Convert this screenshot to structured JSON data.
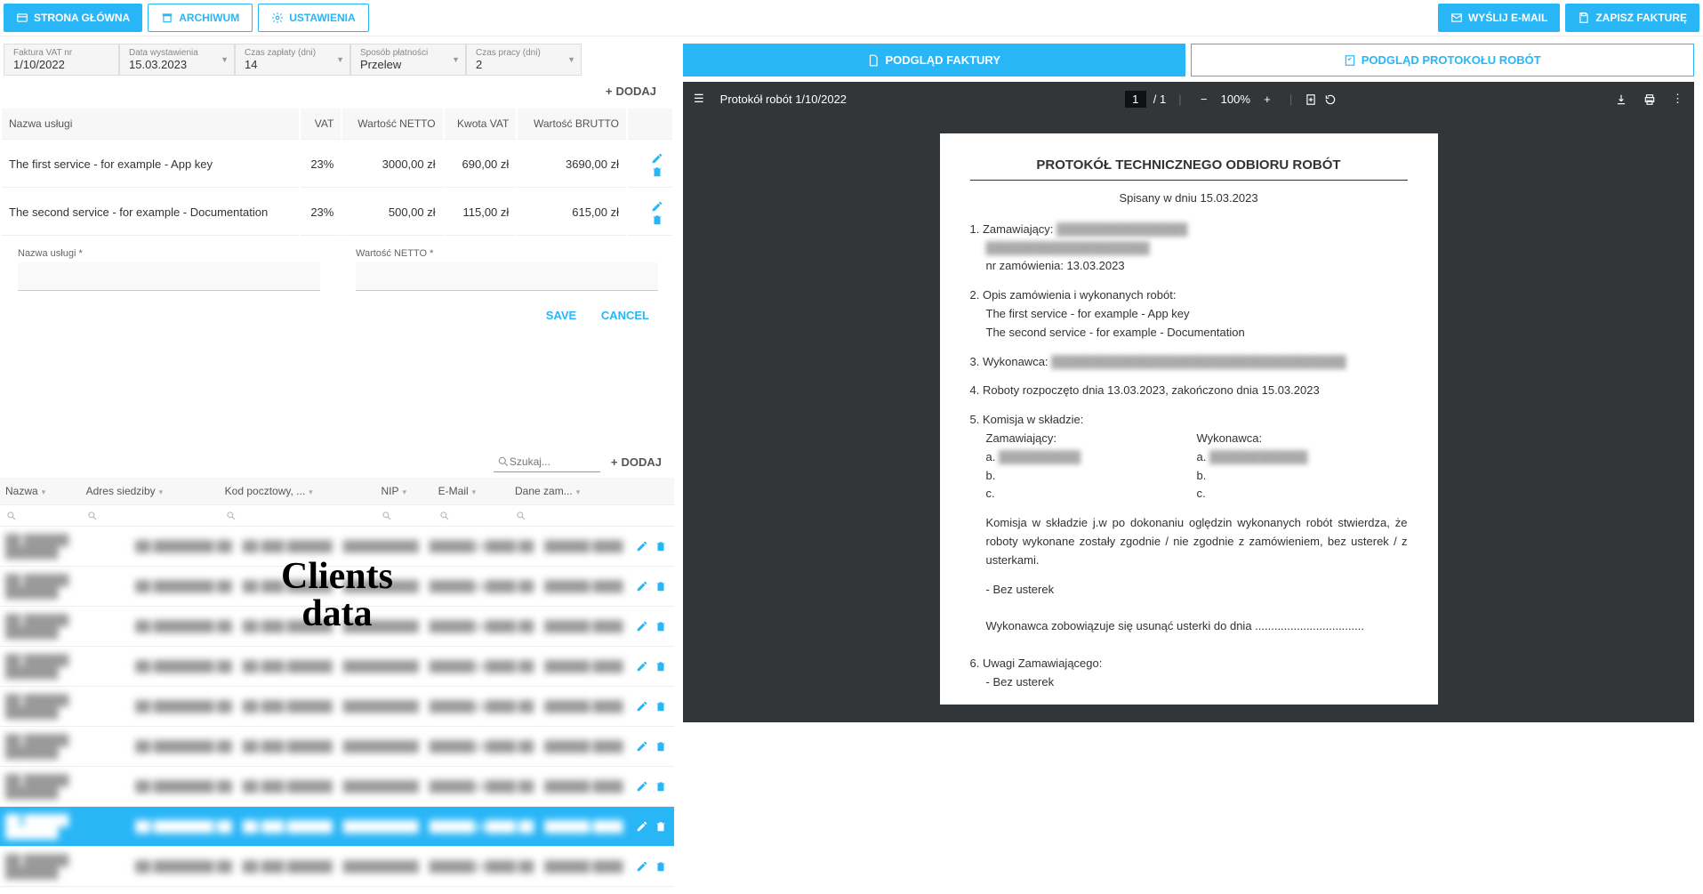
{
  "nav": {
    "home": "STRONA GŁÓWNA",
    "archive": "ARCHIWUM",
    "settings": "USTAWIENIA",
    "send_email": "WYŚLIJ E-MAIL",
    "save_invoice": "ZAPISZ FAKTURĘ"
  },
  "invoice_form": {
    "number_label": "Faktura VAT nr",
    "number_value": "1/10/2022",
    "date_label": "Data wystawienia",
    "date_value": "15.03.2023",
    "payment_time_label": "Czas zapłaty (dni)",
    "payment_time_value": "14",
    "payment_method_label": "Sposób płatności",
    "payment_method_value": "Przelew",
    "work_time_label": "Czas pracy (dni)",
    "work_time_value": "2"
  },
  "add_label": "DODAJ",
  "services": {
    "headers": {
      "name": "Nazwa usługi",
      "vat": "VAT",
      "netto": "Wartość NETTO",
      "vat_amount": "Kwota VAT",
      "brutto": "Wartość BRUTTO"
    },
    "rows": [
      {
        "name": "The first service - for example - App key",
        "vat": "23%",
        "netto": "3000,00 zł",
        "vat_amount": "690,00 zł",
        "brutto": "3690,00 zł"
      },
      {
        "name": "The second service - for example - Documentation",
        "vat": "23%",
        "netto": "500,00 zł",
        "vat_amount": "115,00 zł",
        "brutto": "615,00 zł"
      }
    ]
  },
  "edit": {
    "name_label": "Nazwa usługi *",
    "netto_label": "Wartość NETTO *",
    "save": "SAVE",
    "cancel": "CANCEL"
  },
  "clients": {
    "search_placeholder": "Szukaj...",
    "add": "DODAJ",
    "headers": {
      "name": "Nazwa",
      "address": "Adres siedziby",
      "postal": "Kod pocztowy, ...",
      "nip": "NIP",
      "email": "E-Mail",
      "order_data": "Dane zam..."
    },
    "overlay": "Clients\ndata"
  },
  "tabs": {
    "invoice_preview": "PODGLĄD FAKTURY",
    "protocol_preview": "PODGLĄD PROTOKOŁU ROBÓT"
  },
  "pdf": {
    "title": "Protokół robót 1/10/2022",
    "page": "1",
    "total": "/ 1",
    "zoom": "100%",
    "doc": {
      "heading": "PROTOKÓŁ TECHNICZNEGO ODBIORU ROBÓT",
      "written": "Spisany w dniu 15.03.2023",
      "p1_label": "1. Zamawiający:",
      "p1_order": "nr zamówienia: 13.03.2023",
      "p2_label": "2. Opis zamówienia i wykonanych robót:",
      "p2_line1": "The first service - for example - App key",
      "p2_line2": "The second service - for example - Documentation",
      "p3_label": "3. Wykonawca:",
      "p4": "4. Roboty rozpoczęto dnia 13.03.2023, zakończono dnia 15.03.2023",
      "p5_label": "5. Komisja w składzie:",
      "p5_left": "Zamawiający:",
      "p5_right": "Wykonawca:",
      "a": "a.",
      "b": "b.",
      "c": "c.",
      "findings": "Komisja w składzie j.w po dokonaniu oględzin wykonanych robót stwierdza, że roboty wykonane zostały zgodnie / nie zgodnie z zamówieniem, bez usterek / z usterkami.",
      "no_defects": "- Bez usterek",
      "obligation": "Wykonawca zobowiązuje się usunąć usterki do dnia ..................................",
      "p6_label": "6. Uwagi Zamawiającego:",
      "p6_line": "- Bez usterek"
    }
  }
}
